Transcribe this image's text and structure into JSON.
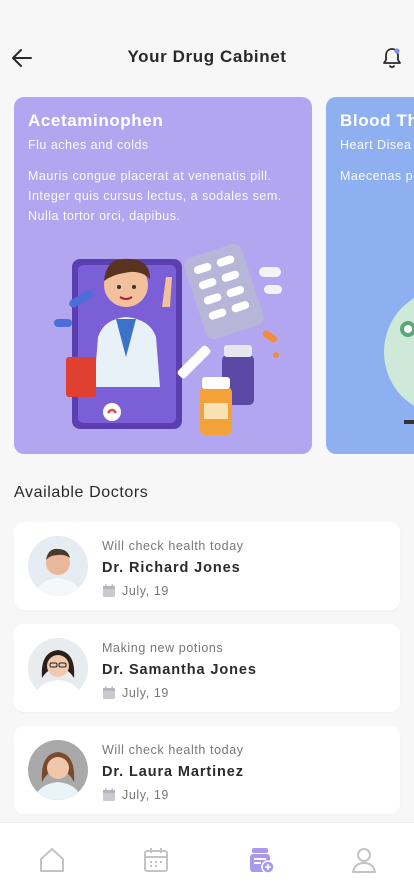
{
  "header": {
    "title": "Your Drug Cabinet",
    "back_icon": "arrow-left-icon",
    "bell_icon": "bell-icon"
  },
  "drugs": [
    {
      "name": "Acetaminophen",
      "subtitle": "Flu aches and colds",
      "description": "Mauris congue placerat at venenatis pill. Integer quis cursus lectus, a sodales sem. Nulla tortor orci, dapibus.",
      "color": "#b3a6f0"
    },
    {
      "name": "Blood Th",
      "subtitle": "Heart Disea",
      "description": "Maecenas p scelerisque dignissim fa",
      "color": "#8fb0f0"
    }
  ],
  "available_doctors": {
    "title": "Available Doctors",
    "items": [
      {
        "note": "Will check health today",
        "name": "Dr. Richard Jones",
        "date": "July, 19"
      },
      {
        "note": "Making new potions",
        "name": "Dr. Samantha Jones",
        "date": "July, 19"
      },
      {
        "note": "Will check health today",
        "name": "Dr. Laura Martinez",
        "date": "July, 19"
      }
    ]
  },
  "bottom_nav": [
    {
      "icon": "home-icon",
      "active": false
    },
    {
      "icon": "calendar-icon",
      "active": false
    },
    {
      "icon": "medicine-cabinet-icon",
      "active": true
    },
    {
      "icon": "profile-icon",
      "active": false
    }
  ],
  "colors": {
    "accent": "#a898ee",
    "nav_inactive": "#c2c2c7",
    "background": "#f7f7f8"
  }
}
